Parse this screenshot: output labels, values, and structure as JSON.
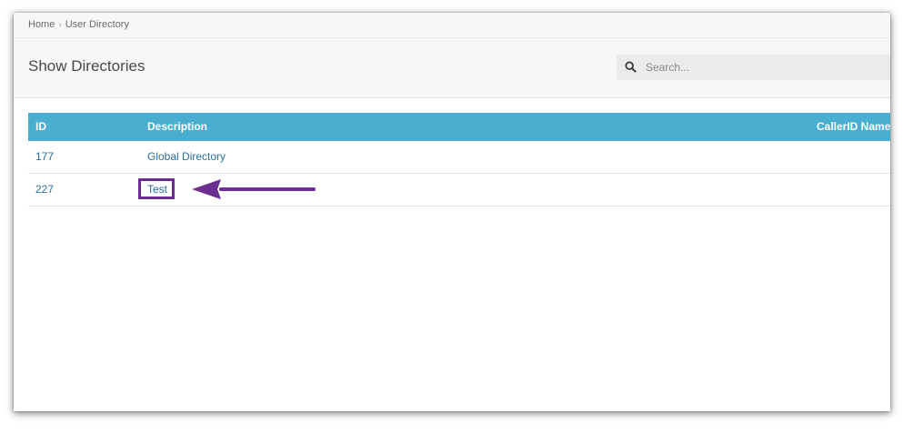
{
  "breadcrumb": {
    "home": "Home",
    "separator": "›",
    "current": "User Directory"
  },
  "header": {
    "title": "Show Directories",
    "search_placeholder": "Search..."
  },
  "table": {
    "columns": [
      "ID",
      "Description",
      "CallerID Name"
    ],
    "rows": [
      {
        "id": "177",
        "description": "Global Directory",
        "callerid_name": ""
      },
      {
        "id": "227",
        "description": "Test",
        "callerid_name": ""
      }
    ]
  },
  "annotation": {
    "highlight_color": "#6a2d91",
    "highlighted_item": "Test"
  },
  "colors": {
    "table_header": "#4aaed1",
    "link": "#2a6e9e"
  }
}
